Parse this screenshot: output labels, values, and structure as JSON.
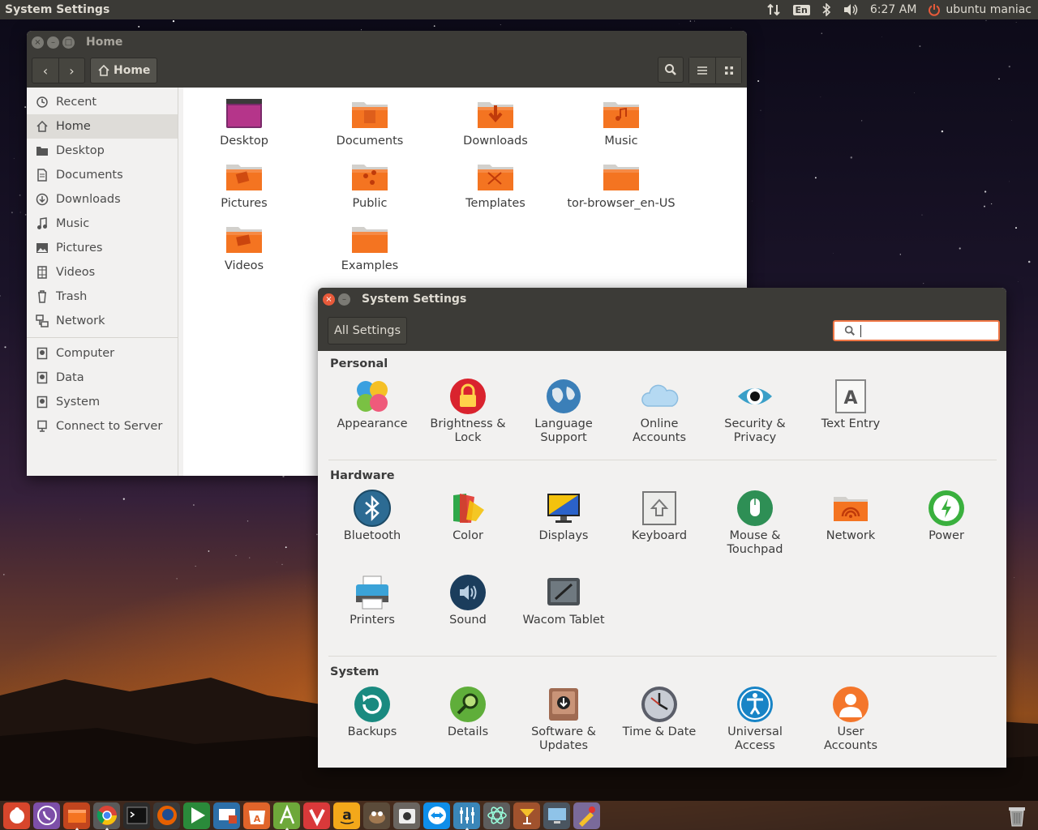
{
  "topbar": {
    "app_title": "System Settings",
    "keyboard_layout": "En",
    "time": "6:27 AM",
    "user": "ubuntu maniac"
  },
  "files_window": {
    "title": "Home",
    "path": "Home",
    "sidebar": {
      "places": [
        "Recent",
        "Home",
        "Desktop",
        "Documents",
        "Downloads",
        "Music",
        "Pictures",
        "Videos",
        "Trash",
        "Network"
      ],
      "devices": [
        "Computer",
        "Data",
        "System",
        "Connect to Server"
      ],
      "selected": "Home"
    },
    "folders": [
      "Desktop",
      "Documents",
      "Downloads",
      "Music",
      "Pictures",
      "Public",
      "Templates",
      "tor-browser_en-US",
      "Videos",
      "Examples"
    ]
  },
  "settings_window": {
    "title": "System Settings",
    "all_settings_label": "All Settings",
    "search_placeholder": "",
    "sections": {
      "personal": {
        "title": "Personal",
        "items": [
          "Appearance",
          "Brightness &\nLock",
          "Language\nSupport",
          "Online\nAccounts",
          "Security &\nPrivacy",
          "Text Entry"
        ]
      },
      "hardware": {
        "title": "Hardware",
        "items": [
          "Bluetooth",
          "Color",
          "Displays",
          "Keyboard",
          "Mouse &\nTouchpad",
          "Network",
          "Power",
          "Printers",
          "Sound",
          "Wacom Tablet"
        ]
      },
      "system": {
        "title": "System",
        "items": [
          "Backups",
          "Details",
          "Software &\nUpdates",
          "Time & Date",
          "Universal\nAccess",
          "User\nAccounts"
        ]
      }
    }
  },
  "dock": {
    "apps": [
      "finder-icon",
      "viber-icon",
      "files-icon",
      "chrome-icon",
      "terminal-icon",
      "firefox-icon",
      "player-icon",
      "remote-icon",
      "store-icon",
      "editor-icon",
      "vivaldi-icon",
      "amazon-icon",
      "gimp-icon",
      "camera-icon",
      "teamviewer-icon",
      "mixer-icon",
      "atom-icon",
      "cocktail-icon",
      "monitor-icon",
      "paint-icon"
    ],
    "trash": "trash-icon"
  },
  "colors": {
    "accent": "#f07746",
    "folder_orange": "#f47421",
    "panel": "#3c3b37"
  }
}
